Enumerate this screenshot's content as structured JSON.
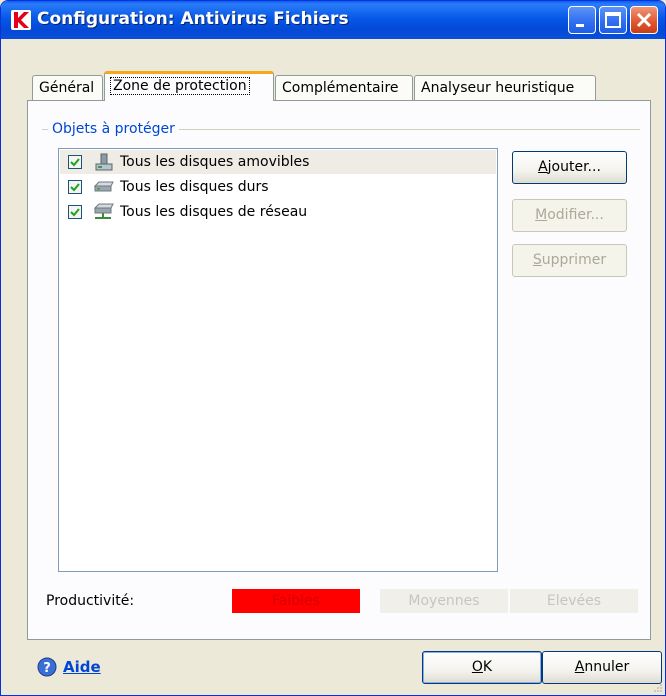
{
  "window": {
    "title": "Configuration: Antivirus Fichiers",
    "app_icon": "kaspersky-k-icon",
    "controls": [
      "minimize-icon",
      "maximize-icon",
      "close-icon"
    ]
  },
  "tabs": [
    {
      "label": "Général",
      "active": false
    },
    {
      "label": "Zone de protection",
      "active": true
    },
    {
      "label": "Complémentaire",
      "active": false
    },
    {
      "label": "Analyseur heuristique",
      "active": false
    }
  ],
  "protection": {
    "group_title": "Objets à protéger",
    "items": [
      {
        "label": "Tous les disques amovibles",
        "checked": true,
        "selected": true,
        "icon": "removable-drive-icon"
      },
      {
        "label": "Tous les disques durs",
        "checked": true,
        "selected": false,
        "icon": "hard-drive-icon"
      },
      {
        "label": "Tous les disques de réseau",
        "checked": true,
        "selected": false,
        "icon": "network-drive-icon"
      }
    ],
    "buttons": {
      "add": {
        "pre": "",
        "mnemonic": "A",
        "post": "jouter...",
        "enabled": true
      },
      "modify": {
        "pre": "",
        "mnemonic": "M",
        "post": "odifier...",
        "enabled": false
      },
      "delete": {
        "pre": "",
        "mnemonic": "S",
        "post": "upprimer",
        "enabled": false
      }
    }
  },
  "productivity": {
    "label": "Productivité:",
    "levels": [
      "Faibles",
      "Moyennes",
      "Elevées"
    ],
    "selected": "Faibles",
    "active_color": "#ff0000"
  },
  "footer": {
    "help_label": "Aide",
    "ok": {
      "pre": "",
      "mnemonic": "O",
      "post": "K"
    },
    "cancel": {
      "pre": "",
      "mnemonic": "A",
      "post": "nnuler"
    }
  },
  "colors": {
    "titlebar": "#0758e8",
    "group_title": "#0046d5",
    "tab_highlight": "#f6a71c"
  }
}
